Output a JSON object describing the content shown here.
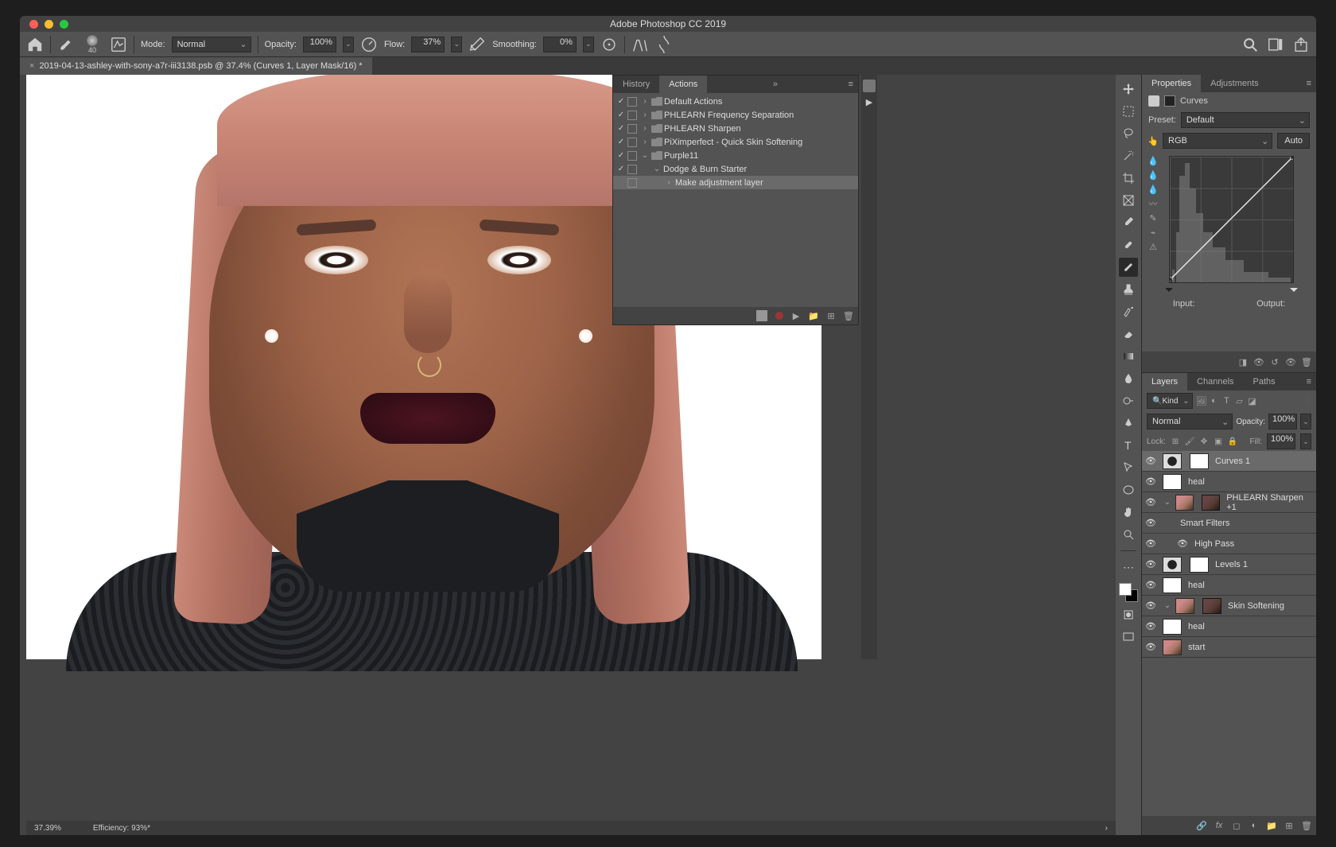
{
  "title": "Adobe Photoshop CC 2019",
  "document_tab": "2019-04-13-ashley-with-sony-a7r-iii3138.psb @ 37.4% (Curves 1, Layer Mask/16) *",
  "options": {
    "brush_size": "40",
    "mode_label": "Mode:",
    "mode_value": "Normal",
    "opacity_label": "Opacity:",
    "opacity_value": "100%",
    "flow_label": "Flow:",
    "flow_value": "37%",
    "smoothing_label": "Smoothing:",
    "smoothing_value": "0%"
  },
  "panels": {
    "history_tab": "History",
    "actions_tab": "Actions",
    "actions": [
      {
        "label": "Default Actions",
        "indent": 0,
        "check": true,
        "folder": true,
        "closed": true
      },
      {
        "label": "PHLEARN Frequency Separation",
        "indent": 0,
        "check": true,
        "folder": true,
        "closed": true
      },
      {
        "label": "PHLEARN Sharpen",
        "indent": 0,
        "check": true,
        "folder": true,
        "closed": true
      },
      {
        "label": "PiXimperfect - Quick Skin Softening",
        "indent": 0,
        "check": true,
        "folder": true,
        "closed": true
      },
      {
        "label": "Purple11",
        "indent": 0,
        "check": true,
        "folder": true,
        "open": true
      },
      {
        "label": "Dodge & Burn Starter",
        "indent": 1,
        "check": true,
        "open": true
      },
      {
        "label": "Make adjustment layer",
        "indent": 2,
        "selected": true,
        "closed": true
      }
    ]
  },
  "properties": {
    "tab": "Properties",
    "adjustments_tab": "Adjustments",
    "kind": "Curves",
    "preset_label": "Preset:",
    "preset_value": "Default",
    "channel": "RGB",
    "auto": "Auto",
    "input_label": "Input:",
    "output_label": "Output:"
  },
  "layers_panel": {
    "tabs": {
      "layers": "Layers",
      "channels": "Channels",
      "paths": "Paths"
    },
    "kind_search": "Kind",
    "blend_mode": "Normal",
    "opacity_label": "Opacity:",
    "opacity_value": "100%",
    "lock_label": "Lock:",
    "fill_label": "Fill:",
    "fill_value": "100%",
    "layers": [
      {
        "name": "Curves 1",
        "type": "adj",
        "selected": true
      },
      {
        "name": "heal",
        "type": "mask"
      },
      {
        "name": "PHLEARN Sharpen +1",
        "type": "smart",
        "group": true
      },
      {
        "name": "Smart Filters",
        "type": "sub",
        "indent": 1,
        "nothumb": true
      },
      {
        "name": "High Pass",
        "type": "filter",
        "indent": 1,
        "nothumb": true
      },
      {
        "name": "Levels 1",
        "type": "adj"
      },
      {
        "name": "heal",
        "type": "mask"
      },
      {
        "name": "Skin Softening",
        "type": "smart",
        "group": true
      },
      {
        "name": "heal",
        "type": "mask"
      },
      {
        "name": "start",
        "type": "im"
      }
    ]
  },
  "status": {
    "zoom": "37.39%",
    "efficiency": "Efficiency: 93%*"
  }
}
